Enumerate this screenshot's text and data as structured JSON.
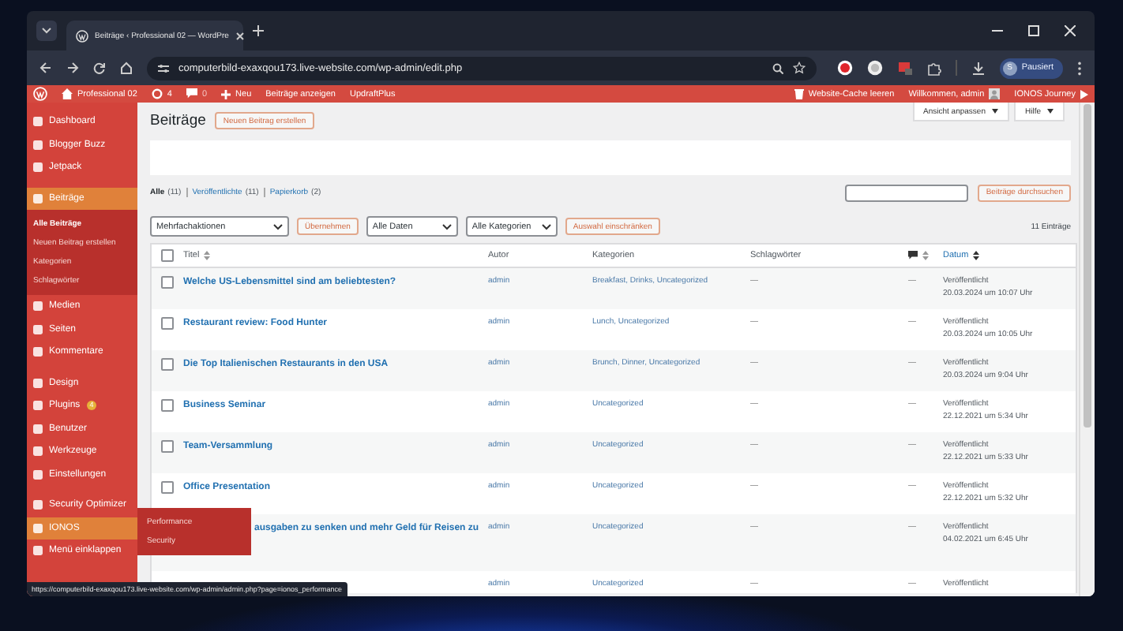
{
  "browser": {
    "tab": {
      "title": "Beiträge ‹ Professional 02 — WordPre"
    },
    "url": "computerbild-exaxqou173.live-website.com/wp-admin/edit.php",
    "profile": {
      "initial": "S",
      "status": "Pausiert"
    }
  },
  "admin_bar": {
    "site": "Professional 02",
    "updates": "4",
    "comments": "0",
    "new": "Neu",
    "links": [
      "Beiträge anzeigen",
      "UpdraftPlus"
    ],
    "cache": "Website-Cache leeren",
    "welcome": "Willkommen, admin",
    "journey": "IONOS Journey"
  },
  "sidebar": {
    "groups": [
      [
        {
          "label": "Dashboard",
          "selected": false,
          "highlighted": false
        },
        {
          "label": "Blogger Buzz",
          "selected": false,
          "highlighted": false
        },
        {
          "label": "Jetpack",
          "selected": false,
          "highlighted": false
        }
      ],
      [
        {
          "label": "Beiträge",
          "selected": true,
          "highlighted": false,
          "children": [
            {
              "label": "Alle Beiträge",
              "selected": true
            },
            {
              "label": "Neuen Beitrag erstellen",
              "selected": false
            },
            {
              "label": "Kategorien",
              "selected": false
            },
            {
              "label": "Schlagwörter",
              "selected": false
            }
          ]
        },
        {
          "label": "Medien",
          "selected": false,
          "highlighted": false
        },
        {
          "label": "Seiten",
          "selected": false,
          "highlighted": false
        },
        {
          "label": "Kommentare",
          "selected": false,
          "highlighted": false
        }
      ],
      [
        {
          "label": "Design",
          "selected": false,
          "highlighted": false
        },
        {
          "label": "Plugins",
          "selected": false,
          "highlighted": false,
          "badge": "4"
        },
        {
          "label": "Benutzer",
          "selected": false,
          "highlighted": false
        },
        {
          "label": "Werkzeuge",
          "selected": false,
          "highlighted": false
        },
        {
          "label": "Einstellungen",
          "selected": false,
          "highlighted": false
        }
      ],
      [
        {
          "label": "Security Optimizer",
          "selected": false,
          "highlighted": false
        },
        {
          "label": "IONOS",
          "selected": false,
          "highlighted": true,
          "flyout": [
            "Performance",
            "Security"
          ]
        },
        {
          "label": "Menü einklappen",
          "selected": false,
          "highlighted": false
        }
      ]
    ]
  },
  "page": {
    "title": "Beiträge",
    "add_new": "Neuen Beitrag erstellen",
    "screen_options": "Ansicht anpassen",
    "help": "Hilfe",
    "views": [
      {
        "label": "Alle",
        "count": "(11)",
        "selected": true
      },
      {
        "label": "Veröffentlichte",
        "count": "(11)",
        "selected": false
      },
      {
        "label": "Papierkorb",
        "count": "(2)",
        "selected": false
      }
    ],
    "search_button": "Beiträge durchsuchen",
    "bulk": "Mehrfachaktionen",
    "apply": "Übernehmen",
    "dates": "Alle Daten",
    "categories": "Alle Kategorien",
    "filter": "Auswahl einschränken",
    "count": "11 Einträge"
  },
  "table": {
    "header_checked": false,
    "columns": [
      {
        "label": "Titel",
        "sorted": false
      },
      {
        "label": "Autor"
      },
      {
        "label": "Kategorien"
      },
      {
        "label": "Schlagwörter"
      },
      {
        "label": "Datum",
        "sorted": true
      }
    ],
    "rows": [
      {
        "kind": "full",
        "checked": false,
        "title": "Welche US-Lebensmittel sind am beliebtesten?",
        "author": "admin",
        "categories": "Breakfast, Drinks, Uncategorized",
        "tags": "—",
        "comments": "—",
        "status": "Veröffentlicht",
        "date": "20.03.2024 um 10:07 Uhr"
      },
      {
        "kind": "full",
        "checked": false,
        "title": "Restaurant review: Food Hunter",
        "author": "admin",
        "categories": "Lunch, Uncategorized",
        "tags": "—",
        "comments": "—",
        "status": "Veröffentlicht",
        "date": "20.03.2024 um 10:05 Uhr"
      },
      {
        "kind": "full",
        "checked": false,
        "title": "Die Top Italienischen Restaurants in den USA",
        "author": "admin",
        "categories": "Brunch, Dinner, Uncategorized",
        "tags": "—",
        "comments": "—",
        "status": "Veröffentlicht",
        "date": "20.03.2024 um 9:04 Uhr"
      },
      {
        "kind": "full",
        "checked": false,
        "title": "Business Seminar",
        "author": "admin",
        "categories": "Uncategorized",
        "tags": "—",
        "comments": "—",
        "status": "Veröffentlicht",
        "date": "22.12.2021 um 5:34 Uhr"
      },
      {
        "kind": "full",
        "checked": false,
        "title": "Team-Versammlung",
        "author": "admin",
        "categories": "Uncategorized",
        "tags": "—",
        "comments": "—",
        "status": "Veröffentlicht",
        "date": "22.12.2021 um 5:33 Uhr"
      },
      {
        "kind": "full",
        "checked": false,
        "title": "Office Presentation",
        "author": "admin",
        "categories": "Uncategorized",
        "tags": "—",
        "comments": "—",
        "status": "Veröffentlicht",
        "date": "22.12.2021 um 5:32 Uhr"
      },
      {
        "kind": "partial",
        "title": "ausgaben zu senken und mehr Geld für Reisen zu",
        "author": "admin",
        "categories": "Uncategorized",
        "tags": "—",
        "comments": "—",
        "status": "Veröffentlicht",
        "date": "04.02.2021 um 6:45 Uhr"
      },
      {
        "kind": "cut",
        "author": "admin",
        "categories": "Uncategorized",
        "tags": "—",
        "comments": "—",
        "status": "Veröffentlicht"
      }
    ]
  },
  "status_url": "https://computerbild-exaxqou173.live-website.com/wp-admin/admin.php?page=ionos_performance"
}
